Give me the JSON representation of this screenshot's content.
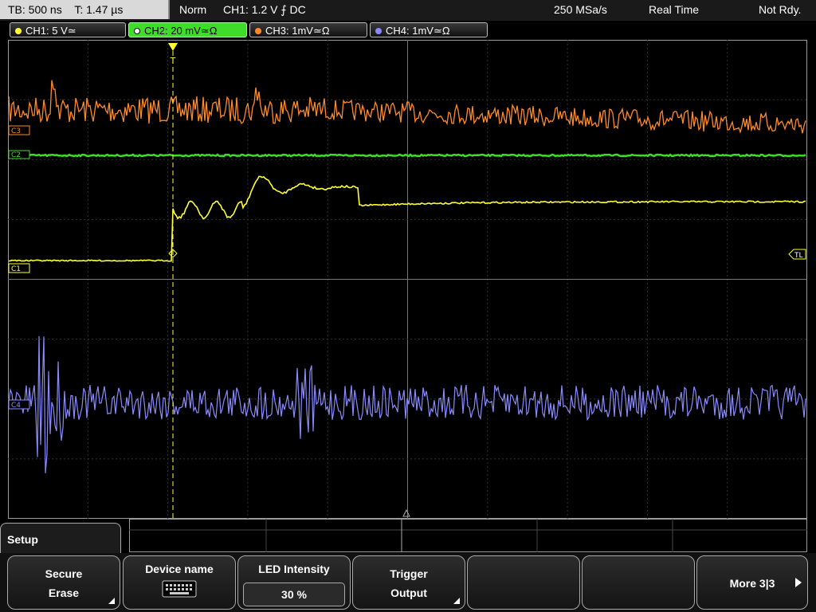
{
  "topbar": {
    "timebase": "TB: 500 ns",
    "trigger_time": "T: 1.47 µs",
    "mode": "Norm",
    "trigger": "CH1: 1.2 V ⨍ DC",
    "sample_rate": "250 MSa/s",
    "acq": "Real Time",
    "status": "Not Rdy."
  },
  "channels": [
    {
      "label": "CH1: 5 V≃",
      "color": "#ffff33"
    },
    {
      "label": "CH2: 20 mV≃Ω",
      "color": "#3fdc2a"
    },
    {
      "label": "CH3: 1mV≃Ω",
      "color": "#ff8a2a"
    },
    {
      "label": "CH4: 1mV≃Ω",
      "color": "#8a8aff"
    }
  ],
  "markers": {
    "c3": "C3",
    "c2": "C2",
    "c1": "C1",
    "c4": "C4",
    "tl": "TL",
    "trigger_pos": "T"
  },
  "setup": {
    "label": "Setup"
  },
  "softkeys": [
    {
      "l1": "Secure",
      "l2": "Erase"
    },
    {
      "l1": "Device name",
      "l2": ""
    },
    {
      "l1": "LED Intensity",
      "l2": "30 %"
    },
    {
      "l1": "Trigger",
      "l2": "Output"
    },
    {
      "l1": "",
      "l2": ""
    },
    {
      "l1": "",
      "l2": ""
    },
    {
      "l1": "More 3|3",
      "l2": ""
    }
  ]
}
